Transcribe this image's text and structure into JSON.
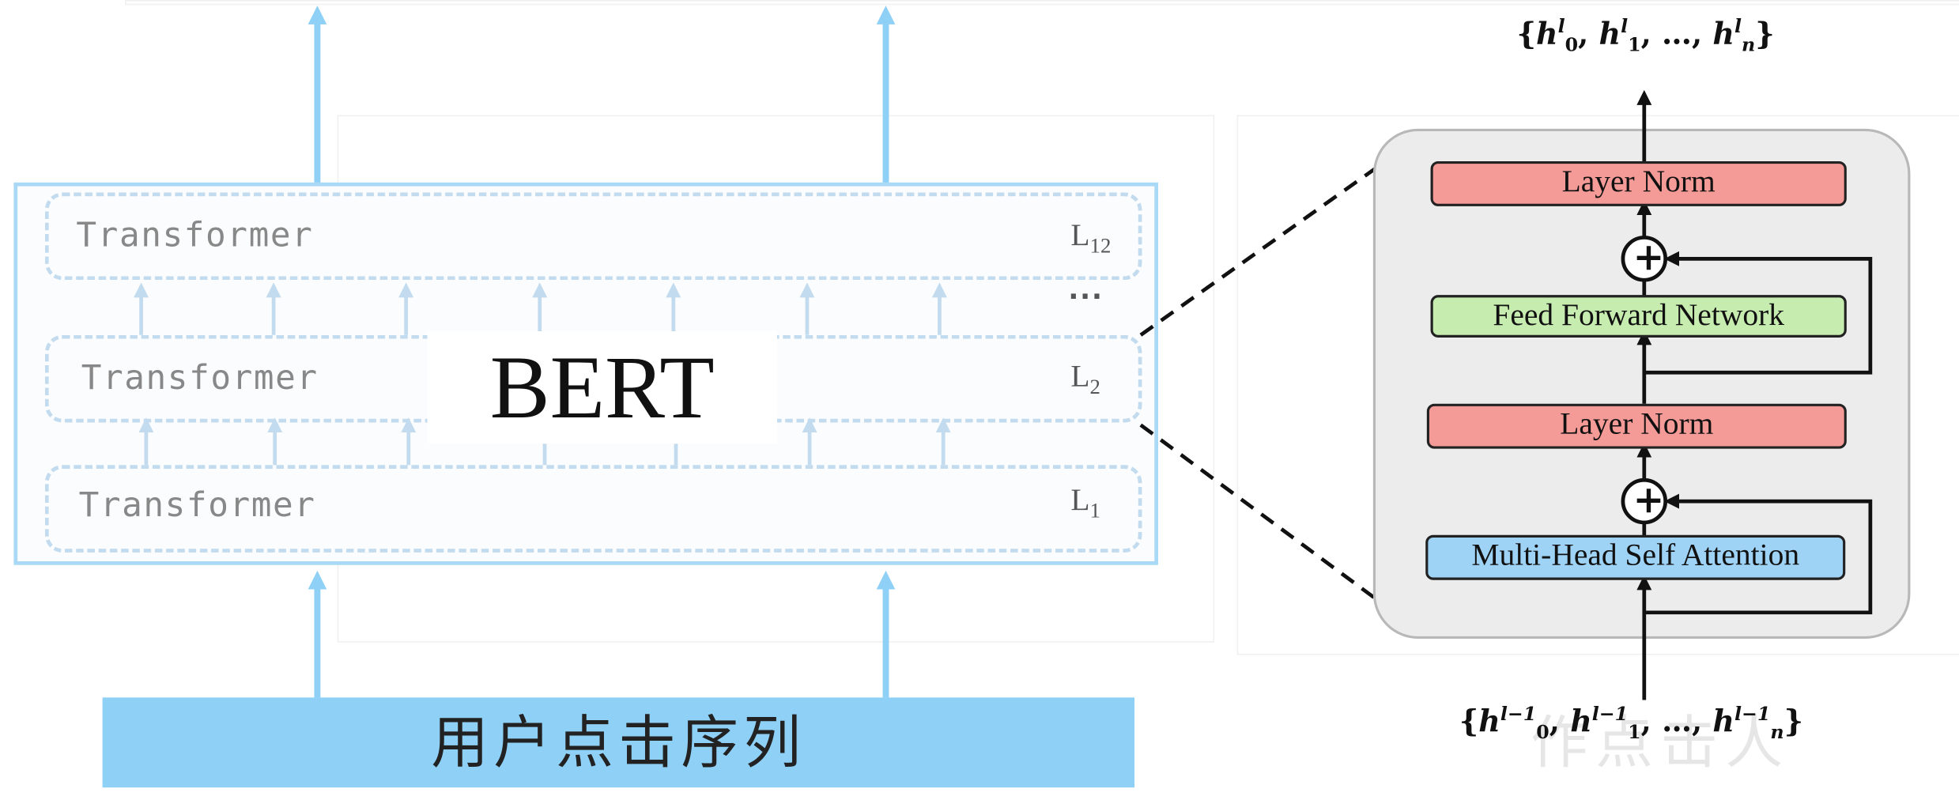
{
  "bert": {
    "title": "BERT",
    "layers": [
      {
        "label": "Transformer",
        "index_base": "L",
        "index_sub": "12"
      },
      {
        "label": "Transformer",
        "index_base": "L",
        "index_sub": "2"
      },
      {
        "label": "Transformer",
        "index_base": "L",
        "index_sub": "1"
      }
    ],
    "ellipsis": "...",
    "input_label": "用户点击序列"
  },
  "transformer_block": {
    "output_math": {
      "open": "{",
      "h": "h",
      "sup": "l",
      "subs": [
        "0",
        "1",
        "n"
      ],
      "sep": ", ",
      "ellipsis": "…",
      "close": "}"
    },
    "input_math": {
      "open": "{",
      "h": "h",
      "sup": "l−1",
      "subs": [
        "0",
        "1",
        "n"
      ],
      "sep": ", ",
      "ellipsis": "…",
      "close": "}"
    },
    "layer_norm_top": "Layer Norm",
    "add_symbol": "+",
    "ffn": "Feed Forward Network",
    "layer_norm_bottom": "Layer Norm",
    "mha": "Multi-Head Self Attention"
  },
  "watermark": "作点击人",
  "colors": {
    "bert_border": "#a9d9f6",
    "arrow_blue": "#8fd0f6",
    "input_bar": "#8fd0f6",
    "layer_norm": "#f59b97",
    "ffn": "#c7ecb0",
    "mha": "#9fd3f6"
  }
}
